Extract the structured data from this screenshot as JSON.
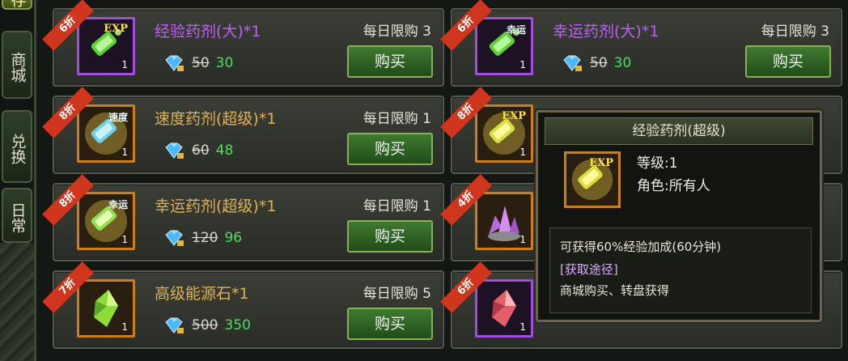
{
  "sidebar": {
    "tabs": [
      {
        "label": "存"
      },
      {
        "label": "商城"
      },
      {
        "label": "兑换"
      },
      {
        "label": "日常"
      }
    ]
  },
  "items": [
    {
      "discount": "6折",
      "tag": "EXP",
      "qty": "1",
      "name": "经验药剂(大)*1",
      "limit": "每日限购 3",
      "old_price": "50",
      "new_price": "30",
      "buy": "购买"
    },
    {
      "discount": "6折",
      "tag": "幸运",
      "qty": "1",
      "name": "幸运药剂(大)*1",
      "limit": "每日限购 3",
      "old_price": "50",
      "new_price": "30",
      "buy": "购买"
    },
    {
      "discount": "8折",
      "tag": "速度",
      "qty": "1",
      "name": "速度药剂(超级)*1",
      "limit": "每日限购 1",
      "old_price": "60",
      "new_price": "48",
      "buy": "购买"
    },
    {
      "discount": "8折",
      "tag": "EXP",
      "qty": "1"
    },
    {
      "discount": "8折",
      "tag": "幸运",
      "qty": "1",
      "name": "幸运药剂(超级)*1",
      "limit": "每日限购 1",
      "old_price": "120",
      "new_price": "96",
      "buy": "购买"
    },
    {
      "discount": "4折",
      "qty": "1"
    },
    {
      "discount": "7折",
      "qty": "1",
      "name": "高级能源石*1",
      "limit": "每日限购 5",
      "old_price": "500",
      "new_price": "350",
      "buy": "购买"
    },
    {
      "discount": "6折",
      "qty": "1"
    }
  ],
  "tooltip": {
    "title": "经验药剂(超级)",
    "tag": "EXP",
    "level": "等级:1",
    "role": "角色:所有人",
    "effect": "可获得60%经验加成(60分钟)",
    "source_title": "[获取途径]",
    "source": "商城购买、转盘获得"
  }
}
